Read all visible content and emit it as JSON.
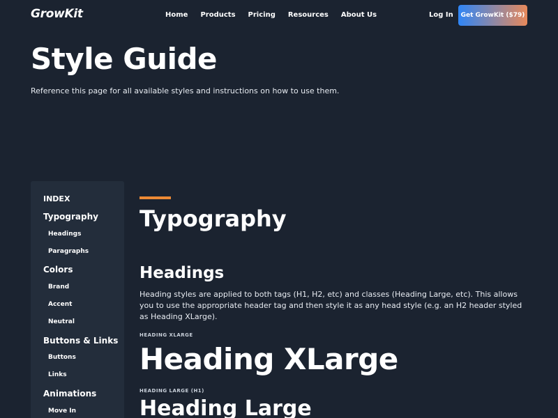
{
  "nav": {
    "logo": "GrowKit",
    "links": [
      "Home",
      "Products",
      "Pricing",
      "Resources",
      "About Us"
    ],
    "login": "Log In",
    "cta": "Get GrowKit ($79)"
  },
  "hero": {
    "title": "Style Guide",
    "subtitle": "Reference this page for all available styles and instructions on how to use them."
  },
  "sidebar": {
    "index_label": "INDEX",
    "items": [
      {
        "label": "Typography"
      },
      {
        "label": "Headings"
      },
      {
        "label": "Paragraphs"
      },
      {
        "label": "Colors"
      },
      {
        "label": "Brand"
      },
      {
        "label": "Accent"
      },
      {
        "label": "Neutral"
      },
      {
        "label": "Buttons & Links"
      },
      {
        "label": "Buttons"
      },
      {
        "label": "Links"
      },
      {
        "label": "Animations"
      },
      {
        "label": "Move In"
      }
    ]
  },
  "content": {
    "section_title": "Typography",
    "headings_title": "Headings",
    "headings_desc": "Heading styles are applied to both tags (H1, H2, etc) and classes (Heading Large, etc). This allows you to use the appropriate header tag and then style it as any head style (e.g. an H2 header styled as Heading XLarge).",
    "xlarge_label": "HEADING XLARGE",
    "xlarge_sample": "Heading XLarge",
    "large_label": "HEADING LARGE (H1)",
    "large_sample": "Heading Large"
  },
  "colors": {
    "background": "#1b2330",
    "sidebar": "#232d3b",
    "accent": "#ed8a35",
    "cta_start": "#2f86f6",
    "cta_end": "#e8895a"
  }
}
